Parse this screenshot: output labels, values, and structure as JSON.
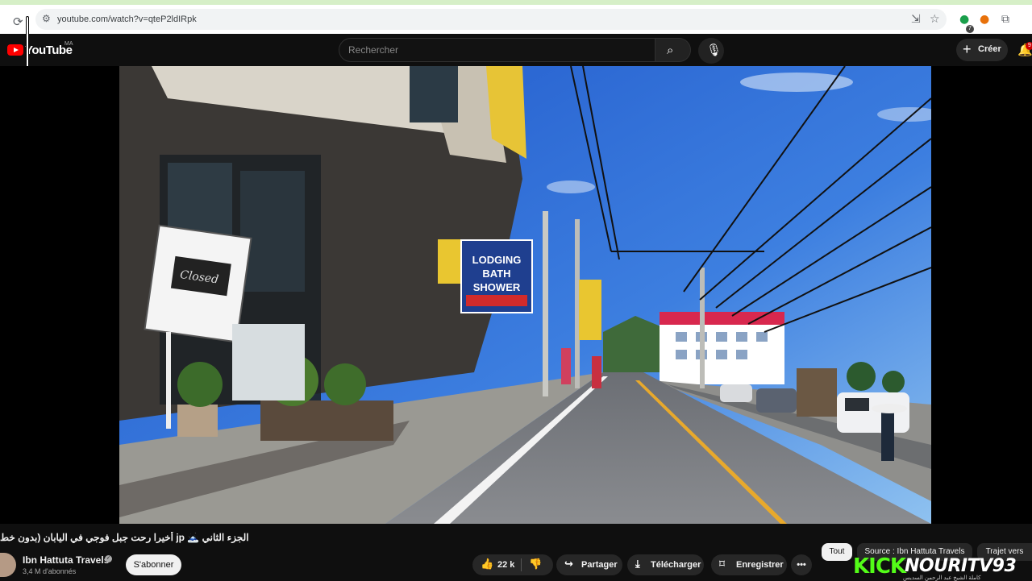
{
  "browser": {
    "url": "youtube.com/watch?v=qteP2ldIRpk",
    "extension_badge": "7"
  },
  "header": {
    "logo_text": "YouTube",
    "country_code": "MA",
    "search_placeholder": "Rechercher",
    "create_label": "Créer",
    "notification_count": "9"
  },
  "video": {
    "scene": "street-view",
    "sign_lodging": "LODGING",
    "sign_bath": "BATH",
    "sign_shower": "SHOWER",
    "sign_closed": "Closed"
  },
  "details": {
    "title": "الجزء الثاني 🗻 jp أخيرا رحت جبل فوجي في اليابان (بدون خط",
    "channel_name": "Ibn Hattuta Travels",
    "subscribers": "3,4 M d'abonnés",
    "subscribe_label": "S'abonner"
  },
  "actions": {
    "likes": "22 k",
    "share_label": "Partager",
    "download_label": "Télécharger",
    "save_label": "Enregistrer",
    "more_label": "•••"
  },
  "chips": [
    {
      "label": "Tout",
      "active": true
    },
    {
      "label": "Source : Ibn Hattuta Travels",
      "active": false
    },
    {
      "label": "Trajet vers",
      "active": false
    }
  ],
  "watermark": {
    "kick_text": "KICK",
    "channel": "NOURITV93",
    "subtitle": "كاملة الشيخ عبد الرحمن السديس"
  }
}
